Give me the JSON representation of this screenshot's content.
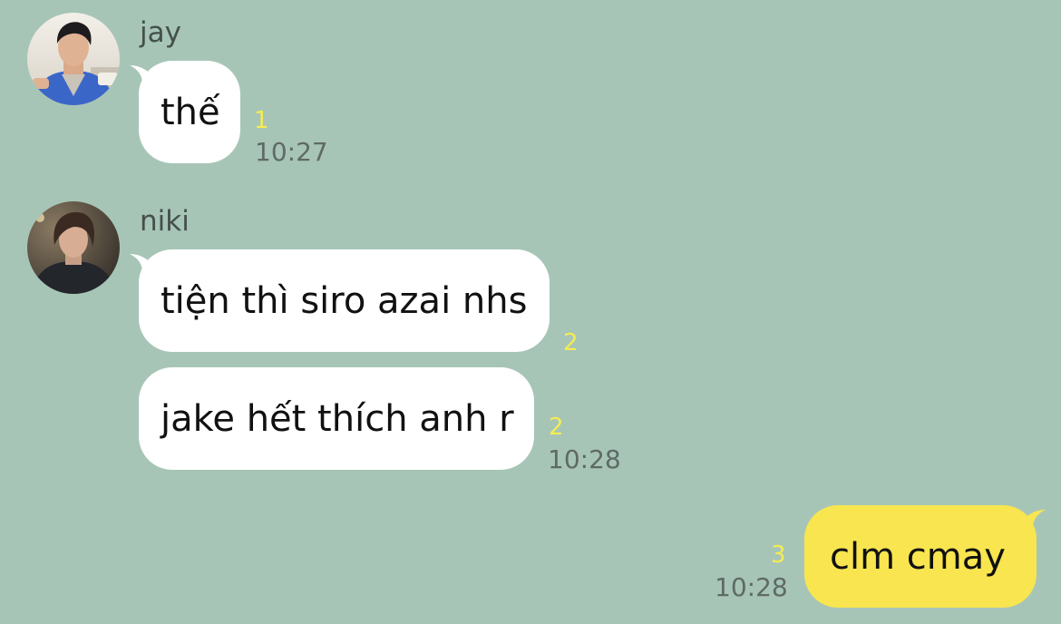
{
  "messages": [
    {
      "sender": "jay",
      "avatar_icon": "profile-photo-jay",
      "bubbles": [
        {
          "text": "thế",
          "unread_count": "1",
          "time": "10:27"
        }
      ]
    },
    {
      "sender": "niki",
      "avatar_icon": "profile-photo-niki",
      "bubbles": [
        {
          "text": "tiện thì siro azai nhs",
          "unread_count": "2",
          "time": ""
        },
        {
          "text": "jake hết thích anh r",
          "unread_count": "2",
          "time": "10:28"
        }
      ]
    },
    {
      "sender": "",
      "outgoing": true,
      "bubbles": [
        {
          "text": "clm cmay",
          "unread_count": "3",
          "time": "10:28"
        }
      ]
    }
  ],
  "colors": {
    "background": "#a7c5b7",
    "incoming_bubble": "#ffffff",
    "outgoing_bubble": "#f8e54f",
    "unread_count": "#f5ec53",
    "timestamp": "#5e6a66"
  }
}
